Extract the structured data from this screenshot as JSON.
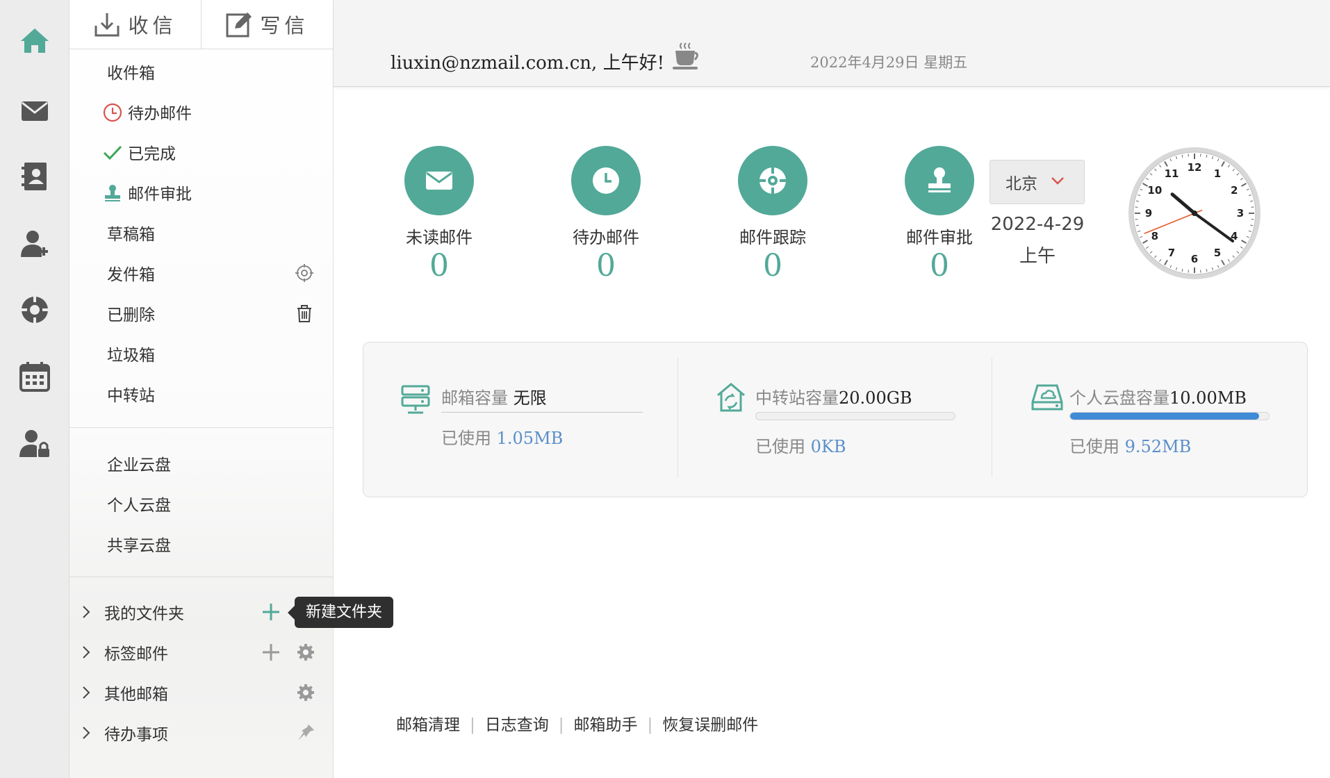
{
  "rail": {
    "items": [
      {
        "name": "home-icon",
        "color": "#52a998"
      },
      {
        "name": "mail-icon",
        "color": "#555"
      },
      {
        "name": "contacts-icon",
        "color": "#555"
      },
      {
        "name": "add-user-icon",
        "color": "#555"
      },
      {
        "name": "tracking-icon",
        "color": "#555"
      },
      {
        "name": "calendar-icon",
        "color": "#555"
      },
      {
        "name": "user-lock-icon",
        "color": "#555"
      }
    ]
  },
  "compose": {
    "receive_label": "收信",
    "write_label": "写信"
  },
  "folders": {
    "inbox": "收件箱",
    "pending": "待办邮件",
    "done": "已完成",
    "approval": "邮件审批",
    "drafts": "草稿箱",
    "sent": "发件箱",
    "deleted": "已删除",
    "spam": "垃圾箱",
    "transfer": "中转站"
  },
  "cloud": {
    "enterprise": "企业云盘",
    "personal": "个人云盘",
    "shared": "共享云盘"
  },
  "tree": {
    "my_folders": "我的文件夹",
    "tag_mail": "标签邮件",
    "other_mailbox": "其他邮箱",
    "todo": "待办事项"
  },
  "tooltip": "新建文件夹",
  "header": {
    "greeting": "liuxin@nzmail.com.cn, 上午好!",
    "date": "2022年4月29日 星期五"
  },
  "stats": [
    {
      "label": "未读邮件",
      "count": "0",
      "icon": "envelope-icon"
    },
    {
      "label": "待办邮件",
      "count": "0",
      "icon": "clock-icon"
    },
    {
      "label": "邮件跟踪",
      "count": "0",
      "icon": "target-icon"
    },
    {
      "label": "邮件审批",
      "count": "0",
      "icon": "stamp-icon"
    }
  ],
  "clock": {
    "city": "北京",
    "date": "2022-4-29",
    "ampm": "上午",
    "time_shown": "10:21"
  },
  "capacity": {
    "mailbox": {
      "title": "邮箱容量",
      "title_value": "无限",
      "used_label": "已使用",
      "used": "1.05MB"
    },
    "transfer": {
      "title": "中转站容量",
      "title_value": "20.00GB",
      "used_label": "已使用",
      "used": "0KB",
      "fraction": 0
    },
    "cloud": {
      "title": "个人云盘容量",
      "title_value": "10.00MB",
      "used_label": "已使用",
      "used": "9.52MB",
      "fraction": 0.952
    }
  },
  "footer": {
    "clean": "邮箱清理",
    "log": "日志查询",
    "assistant": "邮箱助手",
    "restore": "恢复误删邮件"
  },
  "colors": {
    "accent": "#52a998",
    "link": "#5b8fc9",
    "progress": "#3f8bd6"
  }
}
